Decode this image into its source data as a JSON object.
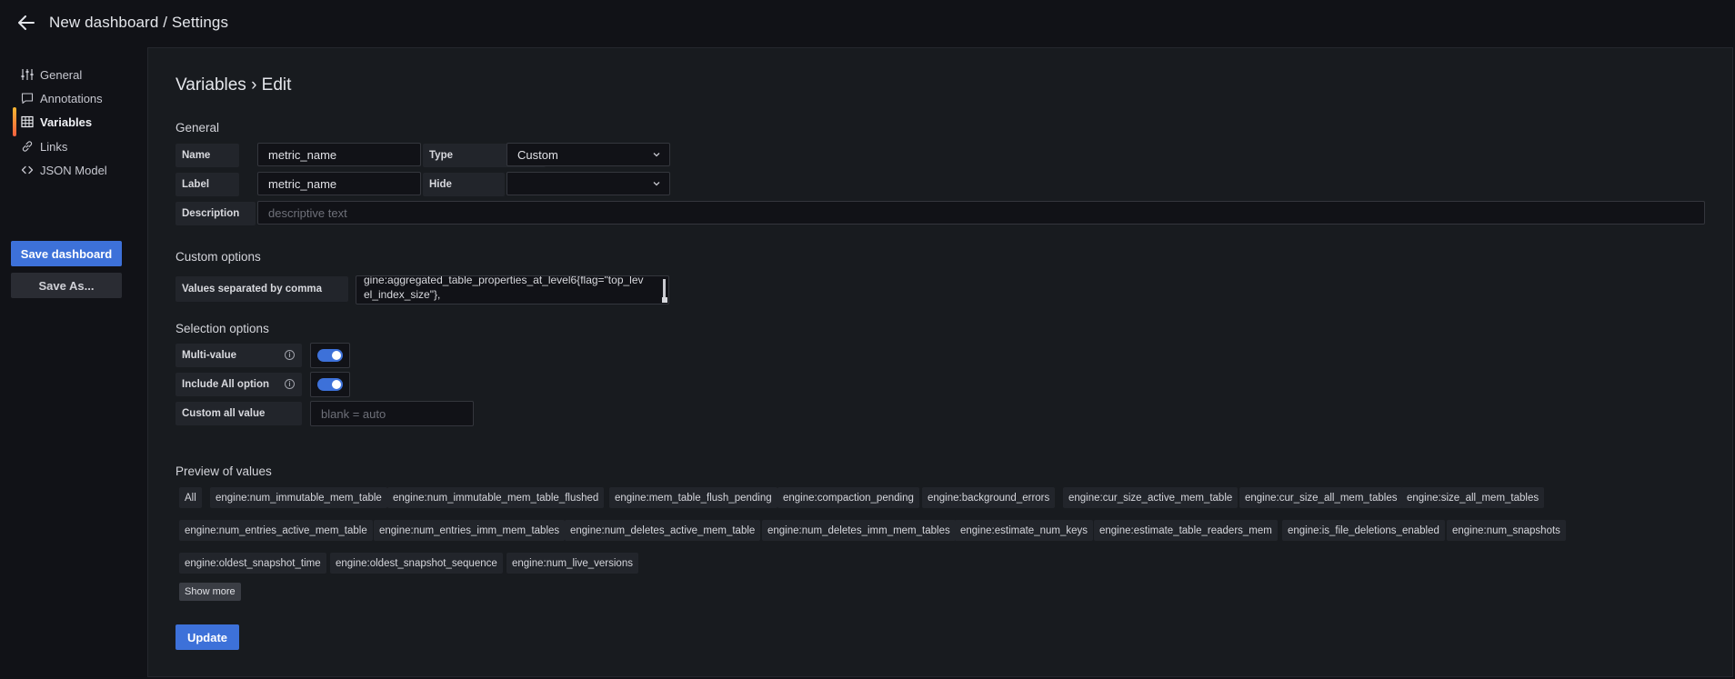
{
  "header": {
    "title": "New dashboard / Settings",
    "back_icon": "arrow-left-icon"
  },
  "sidebar": {
    "items": [
      {
        "label": "General",
        "icon": "sliders-icon",
        "active": false
      },
      {
        "label": "Annotations",
        "icon": "comment-icon",
        "active": false
      },
      {
        "label": "Variables",
        "icon": "table-icon",
        "active": true
      },
      {
        "label": "Links",
        "icon": "link-icon",
        "active": false
      },
      {
        "label": "JSON Model",
        "icon": "code-icon",
        "active": false
      }
    ],
    "save_label": "Save dashboard",
    "save_as_label": "Save As..."
  },
  "page": {
    "title": "Variables › Edit",
    "general_title": "General",
    "name_label": "Name",
    "name_value": "metric_name",
    "type_label": "Type",
    "type_value": "Custom",
    "label_label": "Label",
    "label_value": "metric_name",
    "hide_label": "Hide",
    "hide_value": "",
    "description_label": "Description",
    "description_placeholder": "descriptive text",
    "custom_title": "Custom options",
    "values_label": "Values separated by comma",
    "values_line1": "gine:aggregated_table_properties_at_level6{flag=\"top_lev",
    "values_line2": "el_index_size\"},",
    "selection_title": "Selection options",
    "multi_value_label": "Multi-value",
    "multi_value_on": true,
    "include_all_label": "Include All option",
    "include_all_on": true,
    "custom_all_label": "Custom all value",
    "custom_all_placeholder": "blank = auto",
    "preview_title": "Preview of values",
    "show_more_label": "Show more",
    "update_label": "Update"
  },
  "preview_rows": [
    [
      "All",
      "engine:num_immutable_mem_table",
      "engine:num_immutable_mem_table_flushed",
      "engine:mem_table_flush_pending",
      "engine:compaction_pending",
      "engine:background_errors",
      "engine:cur_size_active_mem_table",
      "engine:cur_size_all_mem_tables",
      "engine:size_all_mem_tables"
    ],
    [
      "engine:num_entries_active_mem_table",
      "engine:num_entries_imm_mem_tables",
      "engine:num_deletes_active_mem_table",
      "engine:num_deletes_imm_mem_tables",
      "engine:estimate_num_keys",
      "engine:estimate_table_readers_mem",
      "engine:is_file_deletions_enabled",
      "engine:num_snapshots"
    ],
    [
      "engine:oldest_snapshot_time",
      "engine:oldest_snapshot_sequence",
      "engine:num_live_versions"
    ]
  ],
  "colors": {
    "accent": "#3d71d9",
    "active_bar": "#f8b632",
    "background": "#111217",
    "panel": "#181b1f"
  }
}
